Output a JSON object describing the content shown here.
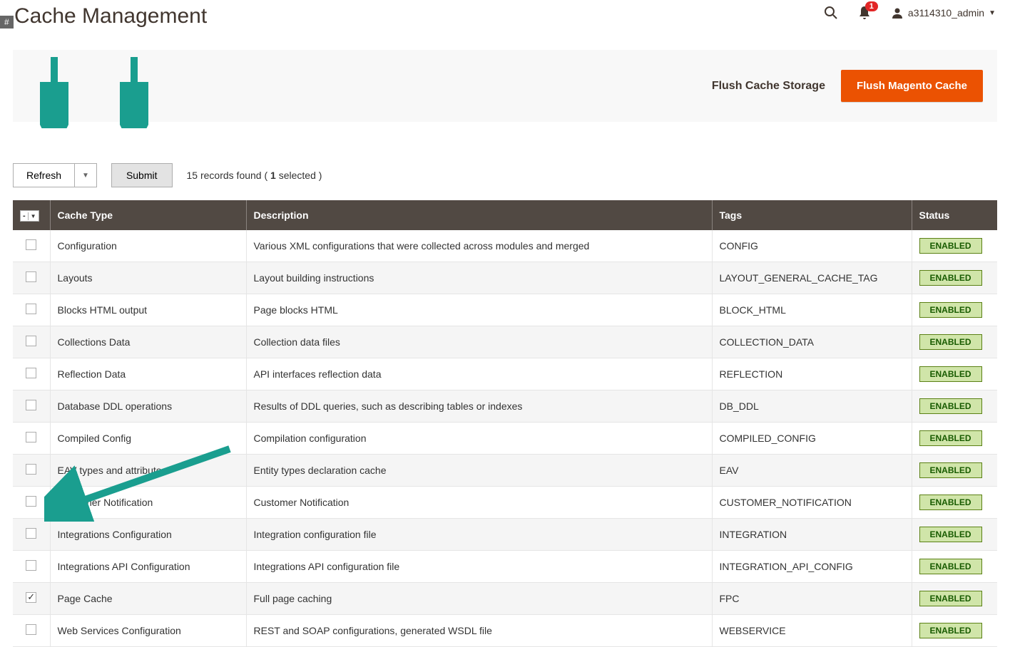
{
  "header": {
    "title": "Cache Management",
    "hash": "#",
    "notifications": "1",
    "username": "a3114310_admin"
  },
  "buttons": {
    "flush_storage": "Flush Cache Storage",
    "flush_magento": "Flush Magento Cache",
    "refresh": "Refresh",
    "submit": "Submit"
  },
  "records": {
    "prefix": "15 records found ( ",
    "selected": "1",
    "suffix": " selected )"
  },
  "columns": {
    "check_label": "-",
    "cache_type": "Cache Type",
    "description": "Description",
    "tags": "Tags",
    "status": "Status"
  },
  "status_label": "ENABLED",
  "rows": [
    {
      "checked": false,
      "type": "Configuration",
      "desc": "Various XML configurations that were collected across modules and merged",
      "tags": "CONFIG"
    },
    {
      "checked": false,
      "type": "Layouts",
      "desc": "Layout building instructions",
      "tags": "LAYOUT_GENERAL_CACHE_TAG"
    },
    {
      "checked": false,
      "type": "Blocks HTML output",
      "desc": "Page blocks HTML",
      "tags": "BLOCK_HTML"
    },
    {
      "checked": false,
      "type": "Collections Data",
      "desc": "Collection data files",
      "tags": "COLLECTION_DATA"
    },
    {
      "checked": false,
      "type": "Reflection Data",
      "desc": "API interfaces reflection data",
      "tags": "REFLECTION"
    },
    {
      "checked": false,
      "type": "Database DDL operations",
      "desc": "Results of DDL queries, such as describing tables or indexes",
      "tags": "DB_DDL"
    },
    {
      "checked": false,
      "type": "Compiled Config",
      "desc": "Compilation configuration",
      "tags": "COMPILED_CONFIG"
    },
    {
      "checked": false,
      "type": "EAV types and attributes",
      "desc": "Entity types declaration cache",
      "tags": "EAV"
    },
    {
      "checked": false,
      "type": "Customer Notification",
      "desc": "Customer Notification",
      "tags": "CUSTOMER_NOTIFICATION"
    },
    {
      "checked": false,
      "type": "Integrations Configuration",
      "desc": "Integration configuration file",
      "tags": "INTEGRATION"
    },
    {
      "checked": false,
      "type": "Integrations API Configuration",
      "desc": "Integrations API configuration file",
      "tags": "INTEGRATION_API_CONFIG"
    },
    {
      "checked": true,
      "type": "Page Cache",
      "desc": "Full page caching",
      "tags": "FPC"
    },
    {
      "checked": false,
      "type": "Web Services Configuration",
      "desc": "REST and SOAP configurations, generated WSDL file",
      "tags": "WEBSERVICE"
    }
  ]
}
